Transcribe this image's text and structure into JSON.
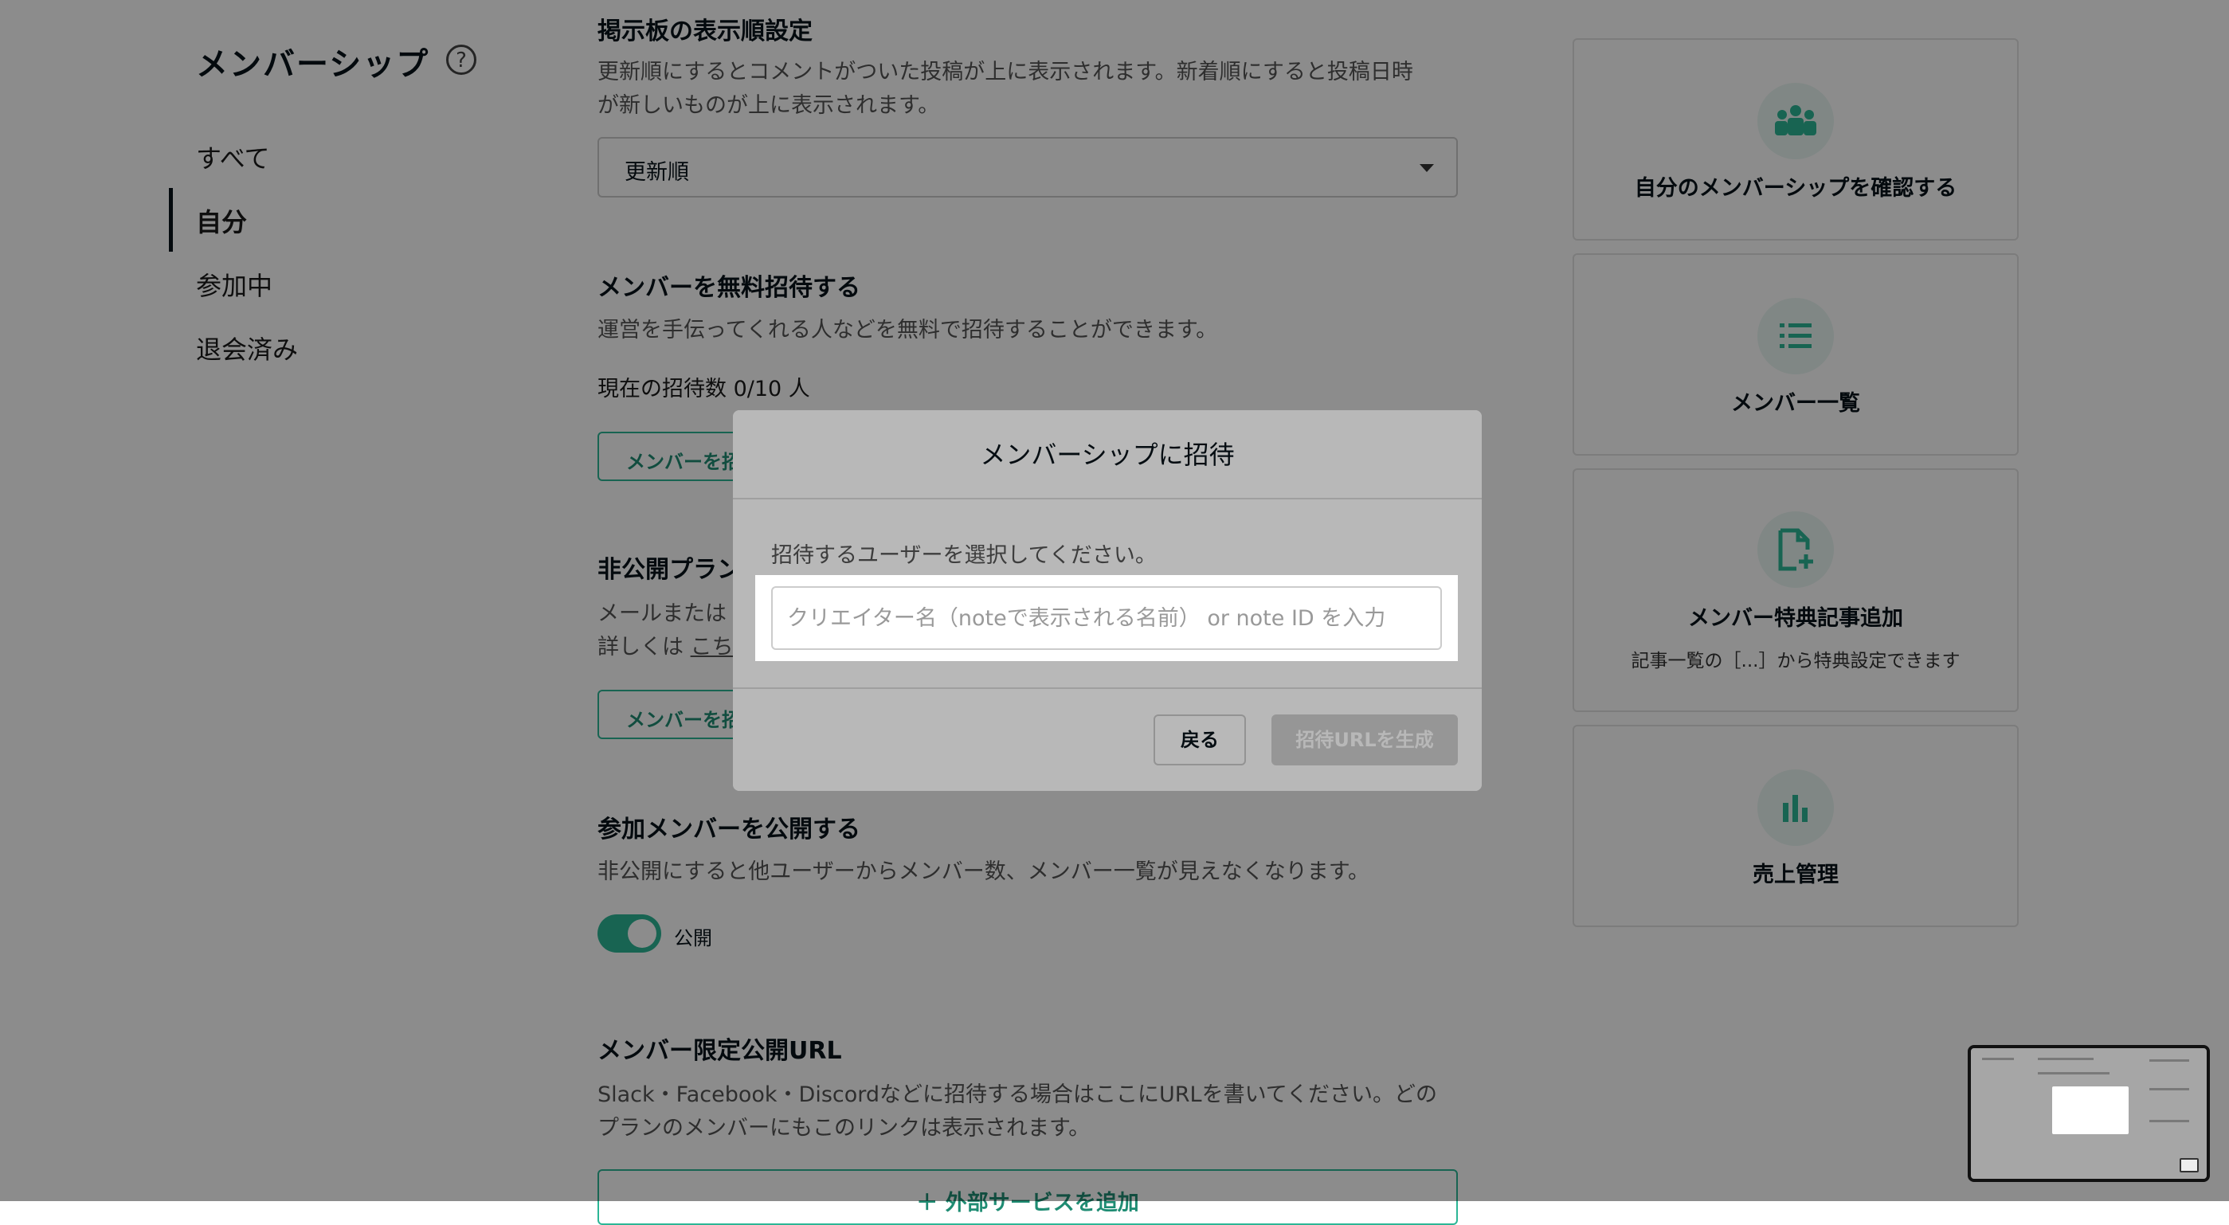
{
  "sidebar": {
    "title": "メンバーシップ",
    "help_icon": "?",
    "items": [
      {
        "label": "すべて",
        "active": false
      },
      {
        "label": "自分",
        "active": true
      },
      {
        "label": "参加中",
        "active": false
      },
      {
        "label": "退会済み",
        "active": false
      }
    ]
  },
  "main": {
    "board_order": {
      "heading": "掲示板の表示順設定",
      "desc_line1": "更新順にするとコメントがついた投稿が上に表示されます。新着順にすると投稿日時",
      "desc_line2": "が新しいものが上に表示されます。",
      "select_value": "更新順"
    },
    "free_invite": {
      "heading": "メンバーを無料招待する",
      "desc": "運営を手伝ってくれる人などを無料で招待することができます。",
      "count_text": "現在の招待数 0/10 人",
      "button_label": "メンバーを招"
    },
    "private_plan": {
      "heading": "非公開プラン",
      "desc_line1": "メールまたは",
      "desc_line2_prefix": "詳しくは ",
      "desc_line2_link": "こち",
      "button_label": "メンバーを招"
    },
    "publish_members": {
      "heading": "参加メンバーを公開する",
      "desc": "非公開にすると他ユーザーからメンバー数、メンバー一覧が見えなくなります。",
      "toggle_on": true,
      "toggle_label": "公開"
    },
    "limited_url": {
      "heading": "メンバー限定公開URL",
      "desc_line1": "Slack・Facebook・Discordなどに招待する場合はここにURLを書いてください。どの",
      "desc_line2": "プランのメンバーにもこのリンクは表示されます。",
      "add_button_label": "＋ 外部サービスを追加"
    }
  },
  "cards": [
    {
      "icon": "people-icon",
      "title": "自分のメンバーシップを確認する",
      "sub": ""
    },
    {
      "icon": "list-icon",
      "title": "メンバー一覧",
      "sub": ""
    },
    {
      "icon": "file-plus-icon",
      "title": "メンバー特典記事追加",
      "sub": "記事一覧の［...］から特典設定できます"
    },
    {
      "icon": "bar-chart-icon",
      "title": "売上管理",
      "sub": ""
    }
  ],
  "modal": {
    "title": "メンバーシップに招待",
    "desc": "招待するユーザーを選択してください。",
    "input_placeholder": "クリエイター名（noteで表示される名前） or note ID を入力",
    "input_value": "",
    "back_label": "戻る",
    "generate_label": "招待URLを生成"
  },
  "colors": {
    "accent": "#2cb696",
    "accent_dark": "#1f8c73",
    "text": "#08131a",
    "overlay": "rgba(0,0,0,0.45)"
  }
}
